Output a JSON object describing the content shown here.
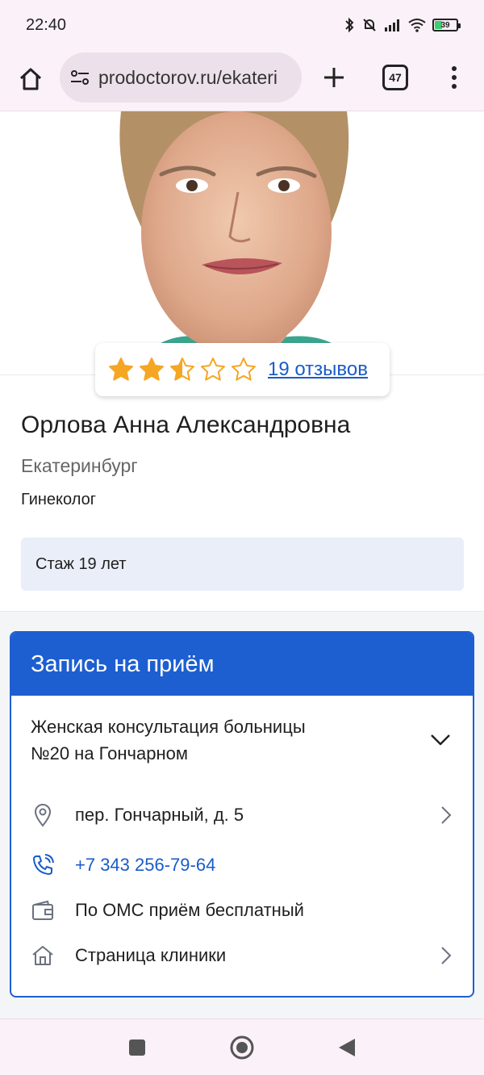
{
  "status_bar": {
    "time": "22:40",
    "battery_level": "39",
    "icons": [
      "bluetooth-icon",
      "bell-off-icon",
      "signal-icon",
      "wifi-icon",
      "battery-icon"
    ]
  },
  "browser": {
    "url": "prodoctorov.ru/ekateri",
    "tab_count": "47",
    "icons": [
      "home-icon",
      "site-settings-icon",
      "new-tab-icon",
      "tabs-icon",
      "menu-icon"
    ]
  },
  "doctor": {
    "rating": 2.5,
    "rating_max": 5,
    "reviews_label": "19 отзывов",
    "name": "Орлова Анна Александровна",
    "city": "Екатеринбург",
    "specialty": "Гинеколог",
    "experience": "Стаж 19 лет"
  },
  "appointment": {
    "header": "Запись на приём",
    "clinic_line1": "Женская консультация больницы",
    "clinic_line2": "№20 на Гончарном",
    "address": "пер. Гончарный, д. 5",
    "phone": "+7 343 256-79-64",
    "payment": "По ОМС приём бесплатный",
    "clinic_page": "Страница клиники"
  },
  "colors": {
    "accent": "#1d5fd1",
    "link": "#1a5cc8",
    "star": "#f5a623",
    "experience_bg": "#eaeef8",
    "chrome_bg": "#fbf1f8"
  }
}
